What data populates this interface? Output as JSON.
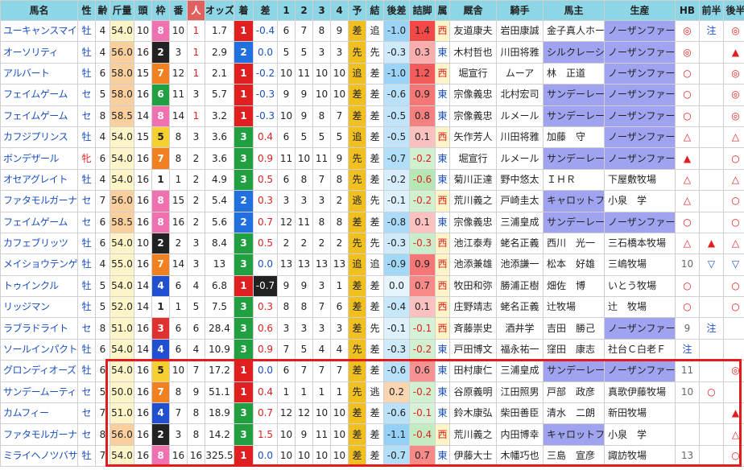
{
  "headers": [
    "馬名",
    "性",
    "齢",
    "斤量",
    "頭",
    "枠",
    "番",
    "人",
    "オッズ",
    "着",
    "差",
    "1",
    "2",
    "3",
    "4",
    "予",
    "結",
    "後差",
    "詰脚",
    "属",
    "厩舎",
    "騎手",
    "馬主",
    "生産",
    "HB",
    "前半",
    "後半"
  ],
  "colors": {
    "waku": {
      "1": "#ffffff",
      "2": "#222222",
      "3": "#e03030",
      "4": "#2050d0",
      "5": "#f6d030",
      "6": "#20a040",
      "7": "#f08020",
      "8": "#f070b0"
    },
    "chaku": {
      "1": "#e02020",
      "2": "#2070e0",
      "3": "#20a040"
    },
    "highlight": "#e41b1b"
  },
  "rows": [
    {
      "name": "ユーキャンスマイル",
      "sex": "牡",
      "age": "4",
      "kin": "54.0",
      "to": "10",
      "waku": "8",
      "ban": "10",
      "nin": "1",
      "odds": "1.7",
      "chaku": "1",
      "sa": "-0.4",
      "c1": "6",
      "c2": "7",
      "c3": "8",
      "c4": "9",
      "yo": "差",
      "ke": "追",
      "ato": "-1.0",
      "tsume": "1.4",
      "zoku": "西",
      "kyu": "友道康夫",
      "kishu": "岩田康誠",
      "bu": "金子真人ホー",
      "sei": "ノーザンファーム",
      "hb": "◎",
      "zen": "注",
      "kou": "◎"
    },
    {
      "name": "オーソリティ",
      "sex": "牡",
      "age": "4",
      "kin": "56.0",
      "to": "16",
      "waku": "2",
      "ban": "3",
      "nin": "1",
      "odds": "2.9",
      "chaku": "2",
      "sa": "0.0",
      "c1": "5",
      "c2": "5",
      "c3": "3",
      "c4": "3",
      "yo": "先",
      "ke": "先",
      "ato": "-0.3",
      "tsume": "0.3",
      "zoku": "東",
      "kyu": "木村哲也",
      "kishu": "川田将雅",
      "bu": "シルクレーシ",
      "sei": "ノーザンファーム",
      "hb": "◎",
      "zen": "",
      "kou": "▲"
    },
    {
      "name": "アルバート",
      "sex": "牡",
      "age": "6",
      "kin": "58.0",
      "to": "15",
      "waku": "7",
      "ban": "12",
      "nin": "1",
      "odds": "2.1",
      "chaku": "1",
      "sa": "-0.2",
      "c1": "10",
      "c2": "11",
      "c3": "10",
      "c4": "10",
      "yo": "追",
      "ke": "差",
      "ato": "-1.0",
      "tsume": "1.2",
      "zoku": "西",
      "kyu": "堀宣行",
      "kishu": "ムーア",
      "bu": "林　正道",
      "sei": "ノーザンファーム",
      "hb": "○",
      "zen": "",
      "kou": "◎"
    },
    {
      "name": "フェイムゲーム",
      "sex": "セ",
      "age": "5",
      "kin": "58.0",
      "to": "16",
      "waku": "6",
      "ban": "11",
      "nin": "3",
      "odds": "5.7",
      "chaku": "1",
      "sa": "-0.3",
      "c1": "9",
      "c2": "9",
      "c3": "10",
      "c4": "10",
      "yo": "差",
      "ke": "差",
      "ato": "-0.6",
      "tsume": "0.9",
      "zoku": "東",
      "kyu": "宗像義忠",
      "kishu": "北村宏司",
      "bu": "サンデーレー",
      "sei": "ノーザンファーム",
      "hb": "○",
      "zen": "",
      "kou": "◎"
    },
    {
      "name": "フェイムゲーム",
      "sex": "セ",
      "age": "8",
      "kin": "58.5",
      "to": "14",
      "waku": "8",
      "ban": "14",
      "nin": "1",
      "odds": "3.2",
      "chaku": "1",
      "sa": "-0.3",
      "c1": "10",
      "c2": "9",
      "c3": "8",
      "c4": "7",
      "yo": "差",
      "ke": "差",
      "ato": "-0.5",
      "tsume": "0.8",
      "zoku": "東",
      "kyu": "宗像義忠",
      "kishu": "ルメール",
      "bu": "サンデーレー",
      "sei": "ノーザンファーム",
      "hb": "○",
      "zen": "",
      "kou": "◎"
    },
    {
      "name": "カフジプリンス",
      "sex": "牡",
      "age": "4",
      "kin": "54.0",
      "to": "15",
      "waku": "5",
      "ban": "8",
      "nin": "3",
      "odds": "3.6",
      "chaku": "3",
      "sa": "0.4",
      "c1": "6",
      "c2": "5",
      "c3": "5",
      "c4": "5",
      "yo": "追",
      "ke": "差",
      "ato": "-0.5",
      "tsume": "0.1",
      "zoku": "西",
      "kyu": "矢作芳人",
      "kishu": "川田将雅",
      "bu": "加藤　守",
      "sei": "ノーザンファーム",
      "hb": "△",
      "zen": "",
      "kou": "△"
    },
    {
      "name": "ボンデザール",
      "sex": "牝",
      "age": "6",
      "kin": "54.0",
      "to": "16",
      "waku": "7",
      "ban": "8",
      "nin": "2",
      "odds": "3.6",
      "chaku": "3",
      "sa": "0.9",
      "c1": "11",
      "c2": "10",
      "c3": "11",
      "c4": "9",
      "yo": "先",
      "ke": "差",
      "ato": "-0.7",
      "tsume": "-0.2",
      "zoku": "東",
      "kyu": "堀宣行",
      "kishu": "ルメール",
      "bu": "サンデーレー",
      "sei": "ノーザンファーム",
      "hb": "▲",
      "zen": "",
      "kou": "○"
    },
    {
      "name": "オセアグレイト",
      "sex": "牡",
      "age": "4",
      "kin": "54.0",
      "to": "16",
      "waku": "1",
      "ban": "1",
      "nin": "2",
      "odds": "4.9",
      "chaku": "3",
      "sa": "0.5",
      "c1": "6",
      "c2": "8",
      "c3": "7",
      "c4": "8",
      "yo": "先",
      "ke": "差",
      "ato": "-0.2",
      "tsume": "-0.6",
      "zoku": "東",
      "kyu": "菊川正達",
      "kishu": "野中悠太",
      "bu": "ＩＨＲ",
      "sei": "下屋敷牧場",
      "hb": "△",
      "zen": "",
      "kou": "△"
    },
    {
      "name": "ファタモルガーナ",
      "sex": "セ",
      "age": "7",
      "kin": "56.0",
      "to": "16",
      "waku": "8",
      "ban": "15",
      "nin": "2",
      "odds": "5.4",
      "chaku": "2",
      "sa": "0.3",
      "c1": "3",
      "c2": "3",
      "c3": "3",
      "c4": "2",
      "yo": "逃",
      "ke": "先",
      "ato": "-0.1",
      "tsume": "-0.2",
      "zoku": "西",
      "kyu": "荒川義之",
      "kishu": "戸崎圭太",
      "bu": "キャロットフ",
      "sei": "小泉　学",
      "hb": "△",
      "zen": "",
      "kou": "○"
    },
    {
      "name": "フェイムゲーム",
      "sex": "セ",
      "age": "6",
      "kin": "58.5",
      "to": "16",
      "waku": "8",
      "ban": "16",
      "nin": "2",
      "odds": "5.6",
      "chaku": "2",
      "sa": "0.7",
      "c1": "12",
      "c2": "11",
      "c3": "8",
      "c4": "8",
      "yo": "差",
      "ke": "差",
      "ato": "-0.8",
      "tsume": "0.1",
      "zoku": "東",
      "kyu": "宗像義忠",
      "kishu": "三浦皇成",
      "bu": "サンデーレー",
      "sei": "ノーザンファーム",
      "hb": "○",
      "zen": "",
      "kou": "○"
    },
    {
      "name": "カフェブリッツ",
      "sex": "牡",
      "age": "6",
      "kin": "54.0",
      "to": "10",
      "waku": "2",
      "ban": "2",
      "nin": "3",
      "odds": "8.4",
      "chaku": "3",
      "sa": "0.5",
      "c1": "2",
      "c2": "2",
      "c3": "2",
      "c4": "2",
      "yo": "先",
      "ke": "先",
      "ato": "-0.3",
      "tsume": "-0.3",
      "zoku": "西",
      "kyu": "池江泰寿",
      "kishu": "蛯名正義",
      "bu": "西川　光一",
      "sei": "三石橋本牧場",
      "hb": "△",
      "zen": "▲",
      "kou": "△"
    },
    {
      "name": "メイショウテンゲン",
      "sex": "牡",
      "age": "4",
      "kin": "55.0",
      "to": "16",
      "waku": "7",
      "ban": "14",
      "nin": "3",
      "odds": "13",
      "chaku": "3",
      "sa": "0.0",
      "c1": "13",
      "c2": "13",
      "c3": "13",
      "c4": "13",
      "yo": "追",
      "ke": "追",
      "ato": "-0.9",
      "tsume": "0.9",
      "zoku": "西",
      "kyu": "池添兼雄",
      "kishu": "池添謙一",
      "bu": "松本　好雄",
      "sei": "三嶋牧場",
      "hb": "10",
      "zen": "▽",
      "kou": "▽"
    },
    {
      "name": "トゥインクル",
      "sex": "牡",
      "age": "5",
      "kin": "54.0",
      "to": "14",
      "waku": "4",
      "ban": "6",
      "nin": "4",
      "odds": "6.8",
      "chaku": "1",
      "sa": "-0.7",
      "c1": "9",
      "c2": "9",
      "c3": "3",
      "c4": "1",
      "yo": "差",
      "ke": "差",
      "ato": "0.0",
      "tsume": "0.7",
      "zoku": "西",
      "kyu": "牧田和弥",
      "kishu": "勝浦正樹",
      "bu": "畑佐　博",
      "sei": "いとう牧場",
      "hb": "○",
      "zen": "",
      "kou": "○"
    },
    {
      "name": "リッジマン",
      "sex": "牡",
      "age": "5",
      "kin": "52.0",
      "to": "14",
      "waku": "1",
      "ban": "1",
      "nin": "5",
      "odds": "7.5",
      "chaku": "3",
      "sa": "0.3",
      "c1": "8",
      "c2": "8",
      "c3": "7",
      "c4": "6",
      "yo": "差",
      "ke": "差",
      "ato": "-0.4",
      "tsume": "0.1",
      "zoku": "西",
      "kyu": "庄野靖志",
      "kishu": "蛯名正義",
      "bu": "辻牧場",
      "sei": "辻　牧場",
      "hb": "○",
      "zen": "",
      "kou": "○"
    },
    {
      "name": "ラブラドライト",
      "sex": "セ",
      "age": "8",
      "kin": "51.0",
      "to": "16",
      "waku": "3",
      "ban": "6",
      "nin": "6",
      "odds": "28.4",
      "chaku": "3",
      "sa": "0.6",
      "c1": "3",
      "c2": "3",
      "c3": "3",
      "c4": "3",
      "yo": "差",
      "ke": "先",
      "ato": "-0.1",
      "tsume": "-0.1",
      "zoku": "西",
      "kyu": "斉藤崇史",
      "kishu": "酒井学",
      "bu": "吉田　勝己",
      "sei": "ノーザンファーム",
      "hb": "9",
      "zen": "注",
      "kou": ""
    },
    {
      "name": "ソールインパクト",
      "sex": "牡",
      "age": "6",
      "kin": "54.0",
      "to": "14",
      "waku": "4",
      "ban": "6",
      "nin": "4",
      "odds": "10.9",
      "chaku": "3",
      "sa": "0.9",
      "c1": "7",
      "c2": "5",
      "c3": "4",
      "c4": "4",
      "yo": "先",
      "ke": "差",
      "ato": "-0.3",
      "tsume": "-0.2",
      "zoku": "東",
      "kyu": "戸田博文",
      "kishu": "福永祐一",
      "bu": "窪田　康志",
      "sei": "社台Ｃ白老Ｆ",
      "hb": "注",
      "zen": "",
      "kou": ""
    },
    {
      "name": "グロンディオーズ",
      "sex": "牡",
      "age": "6",
      "kin": "54.0",
      "to": "16",
      "waku": "5",
      "ban": "10",
      "nin": "7",
      "odds": "17.2",
      "chaku": "1",
      "sa": "0.0",
      "c1": "6",
      "c2": "7",
      "c3": "7",
      "c4": "7",
      "yo": "差",
      "ke": "差",
      "ato": "-0.6",
      "tsume": "0.6",
      "zoku": "東",
      "kyu": "田村康仁",
      "kishu": "三浦皇成",
      "bu": "サンデーレー",
      "sei": "ノーザンファーム",
      "hb": "11",
      "zen": "",
      "kou": "◎"
    },
    {
      "name": "サンデームーティエ",
      "sex": "セ",
      "age": "5",
      "kin": "50.0",
      "to": "16",
      "waku": "7",
      "ban": "8",
      "nin": "9",
      "odds": "51.1",
      "chaku": "1",
      "sa": "0.4",
      "c1": "1",
      "c2": "1",
      "c3": "1",
      "c4": "1",
      "yo": "先",
      "ke": "逃",
      "ato": "0.2",
      "tsume": "-0.2",
      "zoku": "東",
      "kyu": "谷原義明",
      "kishu": "江田照男",
      "bu": "戸部　政彦",
      "sei": "真歌伊藤牧場",
      "hb": "10",
      "zen": "○",
      "kou": ""
    },
    {
      "name": "カムフィー",
      "sex": "セ",
      "age": "7",
      "kin": "51.0",
      "to": "16",
      "waku": "4",
      "ban": "7",
      "nin": "8",
      "odds": "18.9",
      "chaku": "3",
      "sa": "0.7",
      "c1": "12",
      "c2": "12",
      "c3": "10",
      "c4": "10",
      "yo": "差",
      "ke": "差",
      "ato": "-0.6",
      "tsume": "-0.1",
      "zoku": "東",
      "kyu": "鈴木康弘",
      "kishu": "柴田善臣",
      "bu": "清水　二朗",
      "sei": "新田牧場",
      "hb": "",
      "zen": "",
      "kou": "▲"
    },
    {
      "name": "ファタモルガーナ",
      "sex": "セ",
      "age": "8",
      "kin": "56.0",
      "to": "16",
      "waku": "2",
      "ban": "3",
      "nin": "8",
      "odds": "14.2",
      "chaku": "3",
      "sa": "1.5",
      "c1": "10",
      "c2": "9",
      "c3": "11",
      "c4": "10",
      "yo": "差",
      "ke": "差",
      "ato": "-1.1",
      "tsume": "-0.4",
      "zoku": "西",
      "kyu": "荒川義之",
      "kishu": "内田博幸",
      "bu": "キャロットフ",
      "sei": "小泉　学",
      "hb": "",
      "zen": "",
      "kou": "△"
    },
    {
      "name": "ミライヘノツバサ",
      "sex": "牡",
      "age": "7",
      "kin": "54.0",
      "to": "16",
      "waku": "8",
      "ban": "16",
      "nin": "16",
      "odds": "325.5",
      "chaku": "1",
      "sa": "0.0",
      "c1": "10",
      "c2": "10",
      "c3": "10",
      "c4": "10",
      "yo": "差",
      "ke": "差",
      "ato": "-0.7",
      "tsume": "0.7",
      "zoku": "東",
      "kyu": "伊藤大士",
      "kishu": "木幡巧也",
      "bu": "三島　宣彦",
      "sei": "諏訪牧場",
      "hb": "13",
      "zen": "",
      "kou": "○"
    }
  ]
}
